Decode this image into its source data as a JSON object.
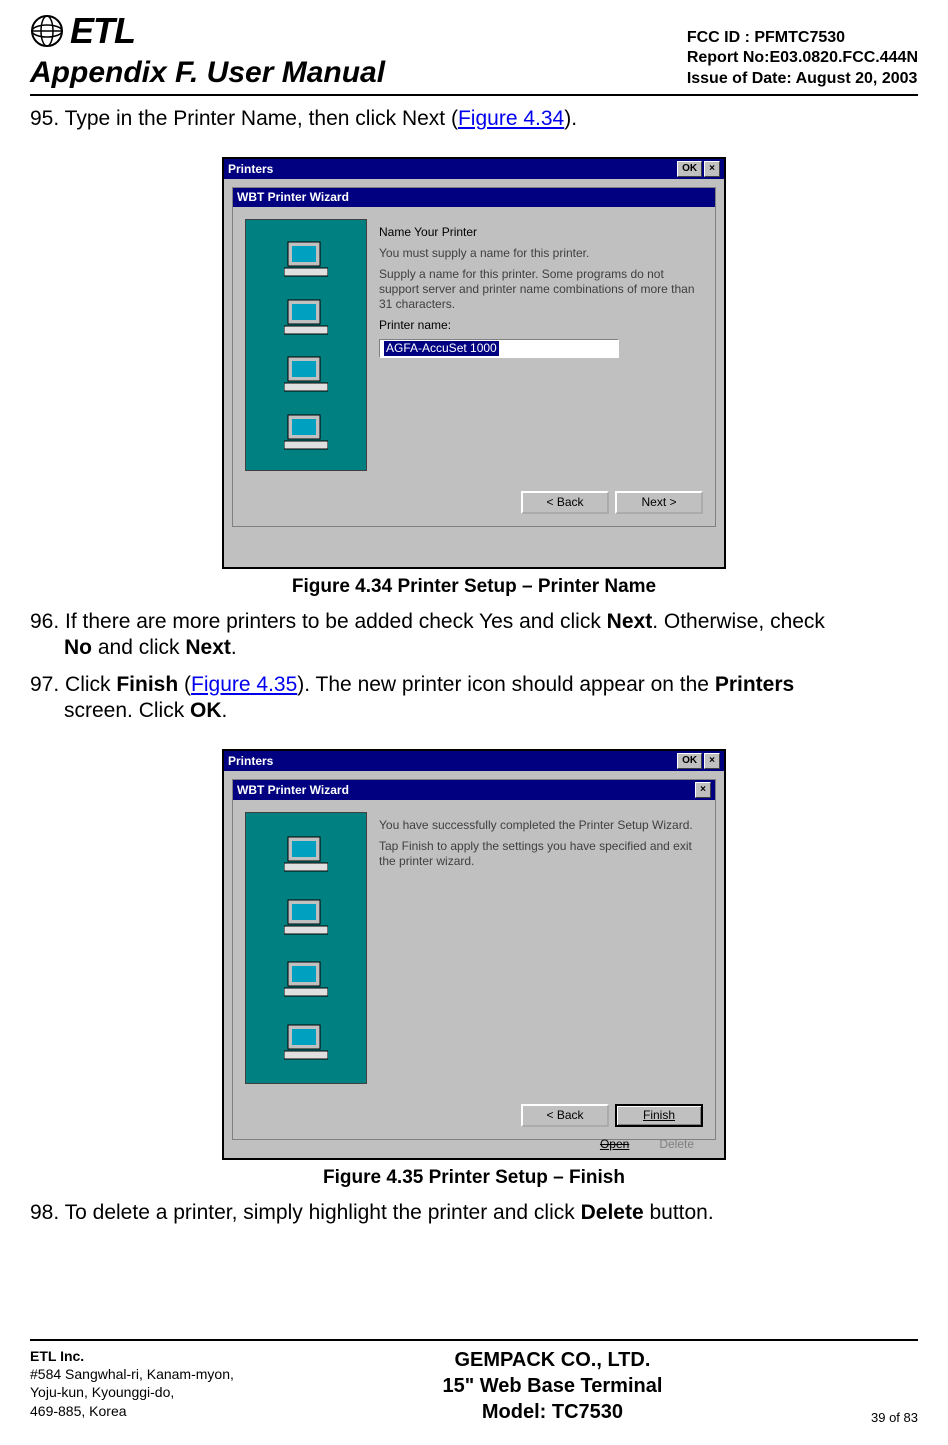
{
  "header": {
    "logo_text": "ETL",
    "appendix_title": "Appendix F. User Manual",
    "fcc_id": "FCC ID : PFMTC7530",
    "report_no": "Report No:E03.0820.FCC.444N",
    "issue_date": "Issue of Date:  August 20, 2003"
  },
  "steps": {
    "s95_pre": "95. Type in the Printer Name, then click Next (",
    "s95_link": "Figure 4.34",
    "s95_post": ").",
    "s96_pre": "96. If there are more printers to be added check Yes and click ",
    "s96_b1": "Next",
    "s96_mid": ".  Otherwise, check ",
    "s96_b2": "No",
    "s96_mid2": " and click ",
    "s96_b3": "Next",
    "s96_end": ".",
    "s97_pre": "97. Click ",
    "s97_b1": "Finish",
    "s97_mid": " (",
    "s97_link": "Figure 4.35",
    "s97_mid2": ").  The new printer icon should appear on the ",
    "s97_b2": "Printers",
    "s97_mid3": " screen.  Click ",
    "s97_b3": "OK",
    "s97_end": ".",
    "s98_pre": "98. To delete a printer, simply highlight the printer and click ",
    "s98_b1": "Delete",
    "s98_end": " button."
  },
  "figure1": {
    "caption": "Figure 4.34   Printer Setup – Printer Name",
    "outer_title": "Printers",
    "outer_ok": "OK",
    "outer_close": "×",
    "inner_title": "WBT Printer Wizard",
    "heading": "Name Your Printer",
    "line1": "You must supply a name for this printer.",
    "line2": "Supply a name for this printer. Some programs do not support server and printer name combinations of more than 31 characters.",
    "field_label": "Printer name:",
    "field_value": "AGFA-AccuSet 1000",
    "btn_back": "< Back",
    "btn_next": "Next >"
  },
  "figure2": {
    "caption": "Figure 4.35   Printer Setup – Finish",
    "outer_title": "Printers",
    "outer_ok": "OK",
    "outer_close": "×",
    "inner_title": "WBT Printer Wizard",
    "inner_close": "×",
    "line1": "You have successfully completed the Printer Setup Wizard.",
    "line2": "Tap Finish to apply the settings you have specified and exit the printer wizard.",
    "btn_back": "<  Back",
    "btn_finish": "Finish",
    "under_open": "Open",
    "under_delete": "Delete"
  },
  "footer": {
    "company": "ETL Inc.",
    "addr1": "#584 Sangwhal-ri, Kanam-myon,",
    "addr2": "Yoju-kun, Kyounggi-do,",
    "addr3": "469-885, Korea",
    "center1": "GEMPACK CO., LTD.",
    "center2": "15\" Web Base Terminal",
    "center3": "Model: TC7530",
    "page": "39 of  83"
  }
}
